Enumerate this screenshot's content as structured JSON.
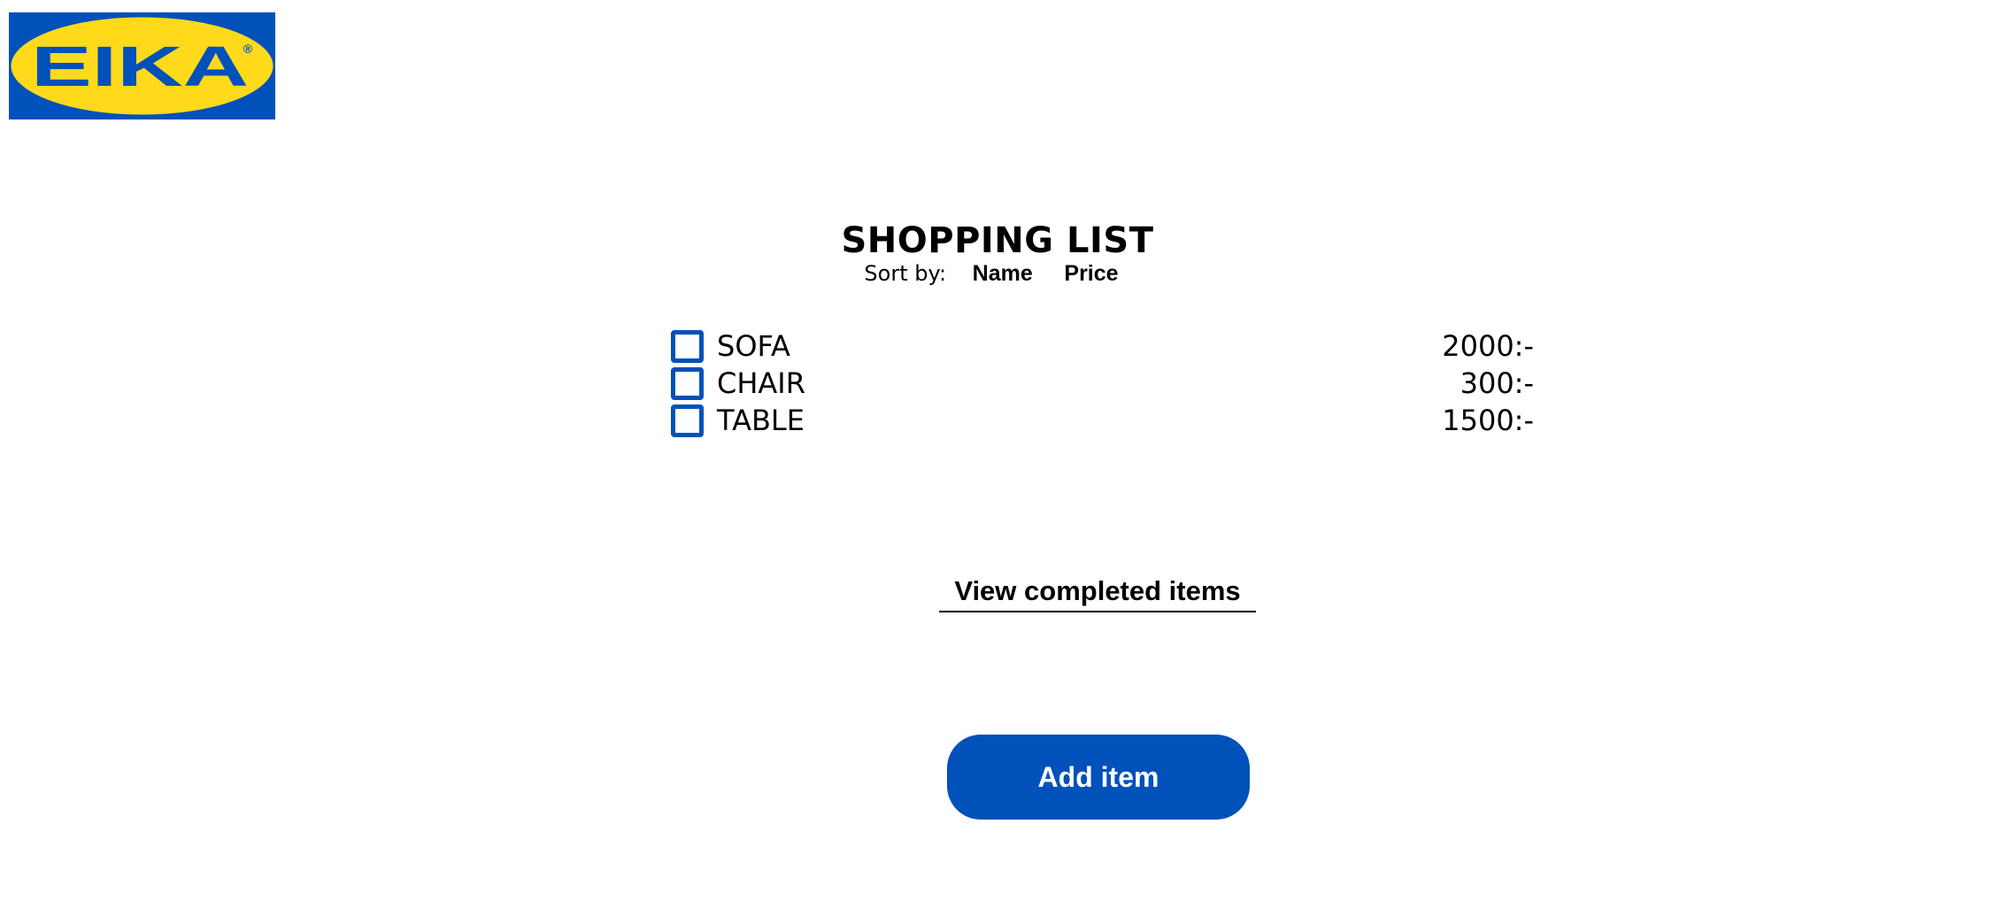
{
  "brand": {
    "logo_text": "EIKA",
    "logo_mark": "®",
    "colors": {
      "blue": "#0051ba",
      "yellow": "#ffda1a"
    }
  },
  "header": {
    "title": "SHOPPING LIST"
  },
  "sort": {
    "label": "Sort by:",
    "options": [
      "Name",
      "Price"
    ]
  },
  "items": [
    {
      "name": "SOFA",
      "price": "2000:-",
      "checked": false
    },
    {
      "name": "CHAIR",
      "price": "300:-",
      "checked": false
    },
    {
      "name": "TABLE",
      "price": "1500:-",
      "checked": false
    }
  ],
  "links": {
    "view_completed": "View completed items"
  },
  "actions": {
    "add_item": "Add item"
  },
  "colors": {
    "accent": "#0051ba",
    "text": "#000000",
    "background": "#ffffff"
  }
}
